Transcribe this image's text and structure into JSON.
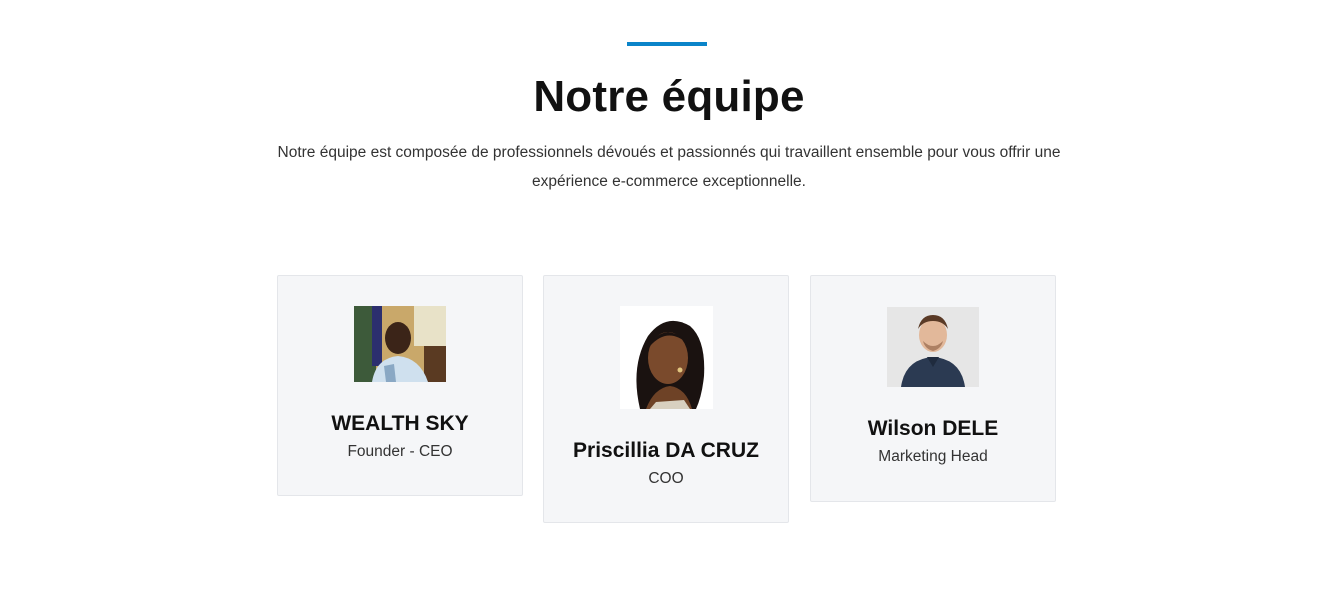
{
  "section": {
    "title": "Notre équipe",
    "description": "Notre équipe est composée de professionnels dévoués et passionnés qui travaillent ensemble pour vous offrir une expérience e-commerce exceptionnelle.",
    "accent_color": "#0a84c9"
  },
  "team": [
    {
      "name": "WEALTH SKY",
      "role": "Founder - CEO",
      "photo": "man-portrait-photo"
    },
    {
      "name": "Priscillia DA CRUZ",
      "role": "COO",
      "photo": "woman-portrait-photo"
    },
    {
      "name": "Wilson DELE",
      "role": "Marketing Head",
      "photo": "man-portrait-photo"
    }
  ],
  "colors": {
    "card_background": "#f5f6f8",
    "card_border": "#e4e6ea"
  }
}
